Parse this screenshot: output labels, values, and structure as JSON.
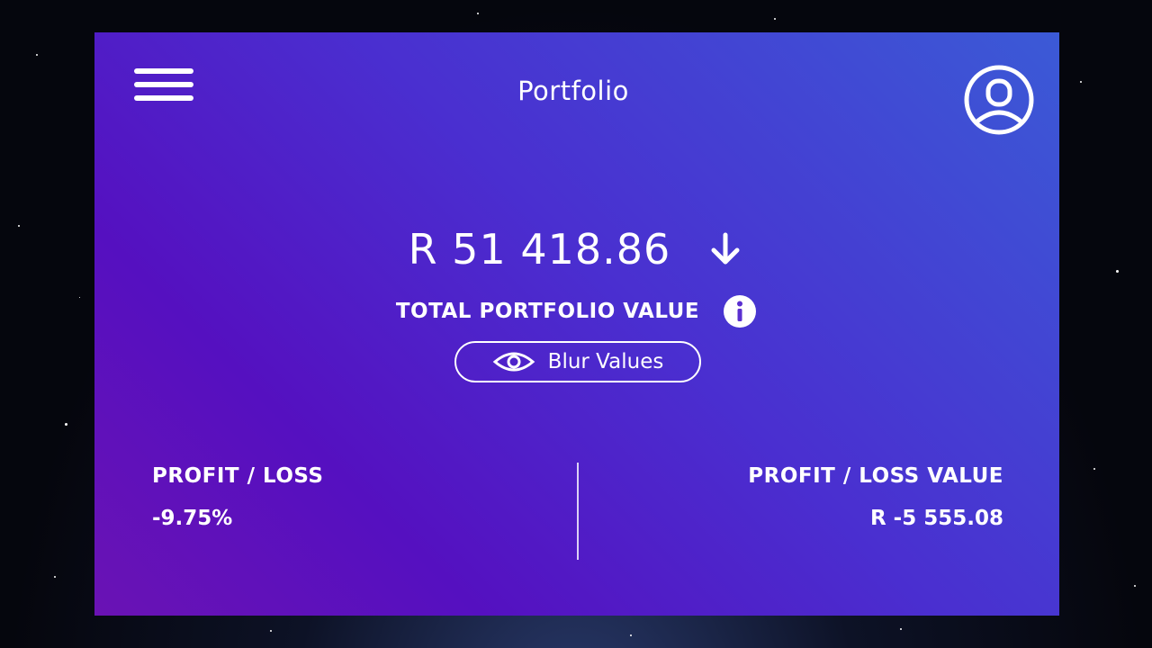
{
  "header": {
    "title": "Portfolio",
    "menu_icon": "hamburger-menu-icon",
    "profile_icon": "user-avatar-icon"
  },
  "portfolio": {
    "total_value": "R 51 418.86",
    "trend_icon": "arrow-down-icon",
    "total_label": "TOTAL PORTFOLIO VALUE",
    "info_icon": "info-icon"
  },
  "blur_toggle": {
    "label": "Blur Values",
    "icon": "eye-icon"
  },
  "profit_loss": {
    "percent_title": "PROFIT / LOSS",
    "percent_value": "-9.75%",
    "value_title": "PROFIT / LOSS VALUE",
    "value": "R -5 555.08"
  },
  "colors": {
    "panel_gradient_start": "#3b5ad6",
    "panel_gradient_end": "#6a12b4",
    "text": "#ffffff"
  }
}
